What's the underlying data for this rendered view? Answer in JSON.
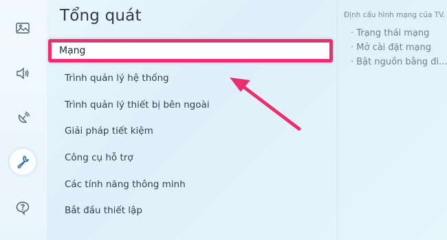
{
  "title": "Tổng quát",
  "menu": {
    "selected": "Mạng",
    "items": [
      "Trình quản lý hệ thống",
      "Trình quản lý thiết bị bên ngoài",
      "Giải pháp tiết kiệm",
      "Công cụ hỗ trợ",
      "Các tính năng thông minh",
      "Bắt đầu thiết lập"
    ]
  },
  "info": {
    "description": "Định cấu hình mạng của TV.",
    "items": [
      "· Trạng thái mạng",
      "· Mở cài đặt mạng",
      "· Bật nguồn bằng đi..."
    ]
  },
  "sidebar": [
    "picture-icon",
    "sound-icon",
    "broadcast-icon",
    "wrench-icon",
    "support-icon"
  ],
  "colors": {
    "highlight": "#e8306e",
    "accent": "#2d6fa3"
  }
}
